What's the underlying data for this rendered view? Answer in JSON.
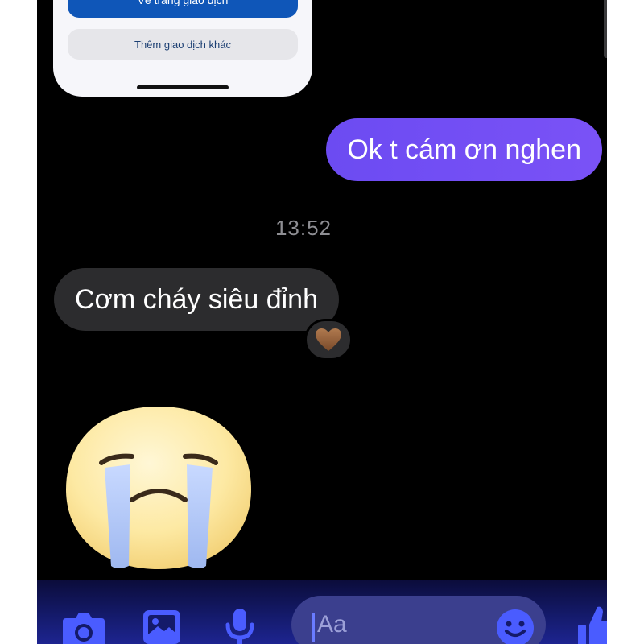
{
  "shared_screenshot": {
    "primary_button_label": "Về trang giao dịch",
    "secondary_button_label": "Thêm giao dịch khác"
  },
  "messages": {
    "sent_text": "Ok t cám ơn nghen",
    "timestamp": "13:52",
    "received_text": "Cơm cháy siêu đỉnh",
    "reaction": "🤎"
  },
  "sticker": {
    "icon": "crying-face-sticker-icon"
  },
  "composer": {
    "placeholder": "Aa",
    "icons": [
      "camera-icon",
      "image-icon",
      "microphone-icon",
      "emoji-icon",
      "thumbs-up-icon"
    ]
  },
  "colors": {
    "sent_bubble": "#7350f4",
    "received_bubble": "#2c2c2e",
    "accent": "#4a5cff",
    "background": "#000000"
  }
}
